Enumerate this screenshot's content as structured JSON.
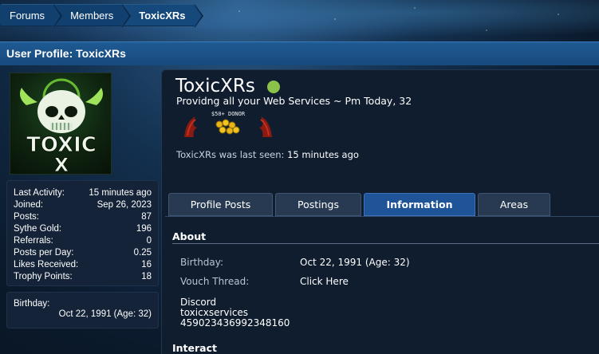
{
  "breadcrumb": [
    "Forums",
    "Members",
    "ToxicXRs"
  ],
  "page_title": "User Profile: ToxicXRs",
  "avatar_text": [
    "TOXIC",
    "X"
  ],
  "stats": [
    {
      "label": "Last Activity:",
      "value": "15 minutes ago"
    },
    {
      "label": "Joined:",
      "value": "Sep 26, 2023"
    },
    {
      "label": "Posts:",
      "value": "87"
    },
    {
      "label": "Sythe Gold:",
      "value": "196"
    },
    {
      "label": "Referrals:",
      "value": "0"
    },
    {
      "label": "Posts per Day:",
      "value": "0.25"
    },
    {
      "label": "Likes Received:",
      "value": "16"
    },
    {
      "label": "Trophy Points:",
      "value": "18"
    }
  ],
  "sidebar_birthday": {
    "label": "Birthday:",
    "value": "Oct 22, 1991 (Age: 32)"
  },
  "profile": {
    "username": "ToxicXRs",
    "status": "Providng all your Web Services ~ Pm Today, 32",
    "badge_text": "$50+ DONOR",
    "last_seen_prefix": "ToxicXRs was last seen:",
    "last_seen_value": "15 minutes ago",
    "online_color": "#8bc34a"
  },
  "tabs": [
    {
      "label": "Profile Posts",
      "active": false
    },
    {
      "label": "Postings",
      "active": false
    },
    {
      "label": "Information",
      "active": true
    },
    {
      "label": "Areas",
      "active": false
    }
  ],
  "about": {
    "title": "About",
    "birthday_label": "Birthday:",
    "birthday_value": "Oct 22, 1991 (Age: 32)",
    "vouch_label": "Vouch Thread:",
    "vouch_value": "Click Here",
    "discord_lines": [
      "Discord",
      "toxicxservices",
      "459023436992348160"
    ]
  },
  "interact": {
    "title": "Interact"
  }
}
